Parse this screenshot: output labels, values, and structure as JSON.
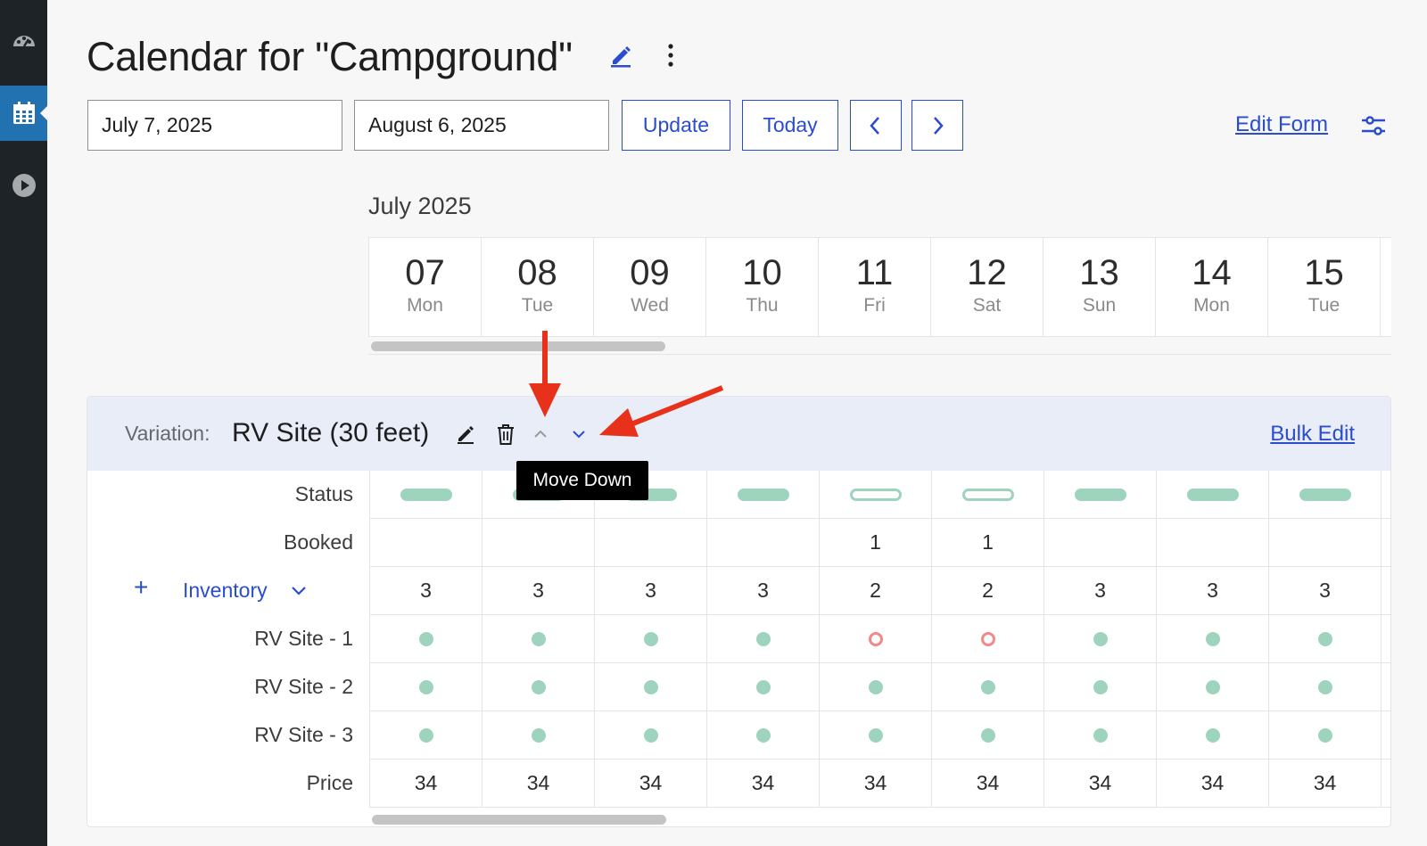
{
  "sidebar": {
    "items": [
      {
        "icon": "dashboard-icon"
      },
      {
        "icon": "calendar-icon",
        "active": true
      },
      {
        "icon": "play-icon"
      }
    ]
  },
  "header": {
    "title": "Calendar for \"Campground\""
  },
  "toolbar": {
    "start_date": "July 7, 2025",
    "end_date": "August 6, 2025",
    "update_label": "Update",
    "today_label": "Today",
    "prev_icon": "chevron-left-icon",
    "next_icon": "chevron-right-icon",
    "edit_form_label": "Edit Form",
    "settings_icon": "sliders-icon"
  },
  "calendar": {
    "month": "July 2025",
    "days": [
      {
        "num": "07",
        "name": "Mon"
      },
      {
        "num": "08",
        "name": "Tue"
      },
      {
        "num": "09",
        "name": "Wed"
      },
      {
        "num": "10",
        "name": "Thu"
      },
      {
        "num": "11",
        "name": "Fri"
      },
      {
        "num": "12",
        "name": "Sat"
      },
      {
        "num": "13",
        "name": "Sun"
      },
      {
        "num": "14",
        "name": "Mon"
      },
      {
        "num": "15",
        "name": "Tue"
      }
    ]
  },
  "variation": {
    "label": "Variation:",
    "name": "RV Site (30 feet)",
    "bulk_edit_label": "Bulk Edit",
    "tooltip": "Move Down",
    "rows": {
      "status_label": "Status",
      "booked_label": "Booked",
      "inventory_label": "Inventory",
      "price_label": "Price"
    },
    "status": [
      "on",
      "on",
      "on",
      "on",
      "off",
      "off",
      "on",
      "on",
      "on"
    ],
    "booked": [
      "",
      "",
      "",
      "",
      "1",
      "1",
      "",
      "",
      ""
    ],
    "inventory": [
      "3",
      "3",
      "3",
      "3",
      "2",
      "2",
      "3",
      "3",
      "3"
    ],
    "units": [
      {
        "name": "RV Site - 1",
        "slots": [
          "free",
          "free",
          "free",
          "free",
          "booked",
          "booked",
          "free",
          "free",
          "free"
        ]
      },
      {
        "name": "RV Site - 2",
        "slots": [
          "free",
          "free",
          "free",
          "free",
          "free",
          "free",
          "free",
          "free",
          "free"
        ]
      },
      {
        "name": "RV Site - 3",
        "slots": [
          "free",
          "free",
          "free",
          "free",
          "free",
          "free",
          "free",
          "free",
          "free"
        ]
      }
    ],
    "price": [
      "34",
      "34",
      "34",
      "34",
      "34",
      "34",
      "34",
      "34",
      "34"
    ]
  },
  "colors": {
    "accent": "#2a4ccf",
    "available": "#9ed4bd",
    "booked": "#f08a8a",
    "annotation_arrow": "#e8311a",
    "sidebar_bg": "#1d2327",
    "sidebar_active": "#2271b1"
  }
}
